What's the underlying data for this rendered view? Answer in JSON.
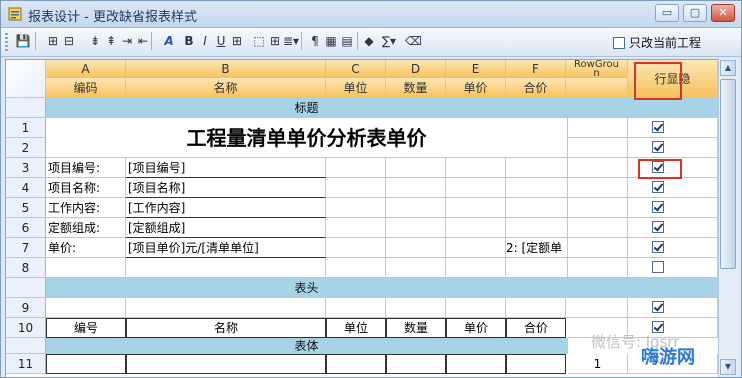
{
  "window": {
    "title": "报表设计 - 更改缺省报表样式",
    "controls": {
      "minimize": "▭",
      "maximize": "▢",
      "close": "✕"
    }
  },
  "toolbar": {
    "buttons": [
      {
        "name": "save-icon",
        "glyph": "💾"
      },
      {
        "name": "merge-cells-icon",
        "glyph": "⊞"
      },
      {
        "name": "unmerge-cells-icon",
        "glyph": "⊟"
      },
      {
        "name": "insert-row-icon",
        "glyph": "⇟"
      },
      {
        "name": "delete-row-icon",
        "glyph": "⇞"
      },
      {
        "name": "insert-column-icon",
        "glyph": "⇥"
      },
      {
        "name": "delete-column-icon",
        "glyph": "⇤"
      },
      {
        "name": "font-icon",
        "glyph": "A"
      },
      {
        "name": "bold-icon",
        "glyph": "B"
      },
      {
        "name": "italic-icon",
        "glyph": "I"
      },
      {
        "name": "underline-icon",
        "glyph": "U"
      },
      {
        "name": "borders-icon",
        "glyph": "⊞"
      },
      {
        "name": "no-border-icon",
        "glyph": "⬚"
      },
      {
        "name": "inner-border-icon",
        "glyph": "⊞"
      },
      {
        "name": "align-dropdown-icon",
        "glyph": "≣▾"
      },
      {
        "name": "format-icon",
        "glyph": "¶"
      },
      {
        "name": "table-icon",
        "glyph": "▦"
      },
      {
        "name": "grid-lines-icon",
        "glyph": "▤"
      },
      {
        "name": "fill-color-icon",
        "glyph": "◆"
      },
      {
        "name": "formula-dropdown-icon",
        "glyph": "∑▾"
      },
      {
        "name": "clear-format-icon",
        "glyph": "⌫"
      }
    ],
    "only_current_project_label": "只改当前工程",
    "only_current_project_checked": false
  },
  "grid": {
    "column_letters": [
      "A",
      "B",
      "C",
      "D",
      "E",
      "F",
      "RowGrou\nn",
      "行显隐"
    ],
    "column_names": [
      "编码",
      "名称",
      "单位",
      "数量",
      "单价",
      "合价",
      "",
      ""
    ],
    "title_band": "标题",
    "header_band": "表头",
    "body_band": "表体",
    "report_title": "工程量清单单价分析表单价",
    "rows": [
      {
        "num": "1",
        "a": "",
        "b": "",
        "visible": true
      },
      {
        "num": "2",
        "a": "",
        "b": "",
        "visible": true
      },
      {
        "num": "3",
        "a": "项目编号:",
        "b": "[项目编号]",
        "visible": true
      },
      {
        "num": "4",
        "a": "项目名称:",
        "b": "[项目名称]",
        "visible": true
      },
      {
        "num": "5",
        "a": "工作内容:",
        "b": "[工作内容]",
        "visible": true
      },
      {
        "num": "6",
        "a": "定额组成:",
        "b": "[定额组成]",
        "visible": true
      },
      {
        "num": "7",
        "a": "单价:",
        "b": "[项目单价]元/[清单单位]",
        "f": "2: [定额单",
        "visible": true
      },
      {
        "num": "8",
        "a": "",
        "b": "",
        "visible": false
      }
    ],
    "header_rows": [
      {
        "num": "9",
        "visible": true
      },
      {
        "num": "10",
        "cells": [
          "编号",
          "名称",
          "单位",
          "数量",
          "单价",
          "合价"
        ],
        "visible": true
      }
    ],
    "body_rows": [
      {
        "num": "11",
        "g": "1"
      }
    ]
  },
  "watermark": {
    "text": "微信号: lgsrr",
    "logo": "嗨游网"
  }
}
